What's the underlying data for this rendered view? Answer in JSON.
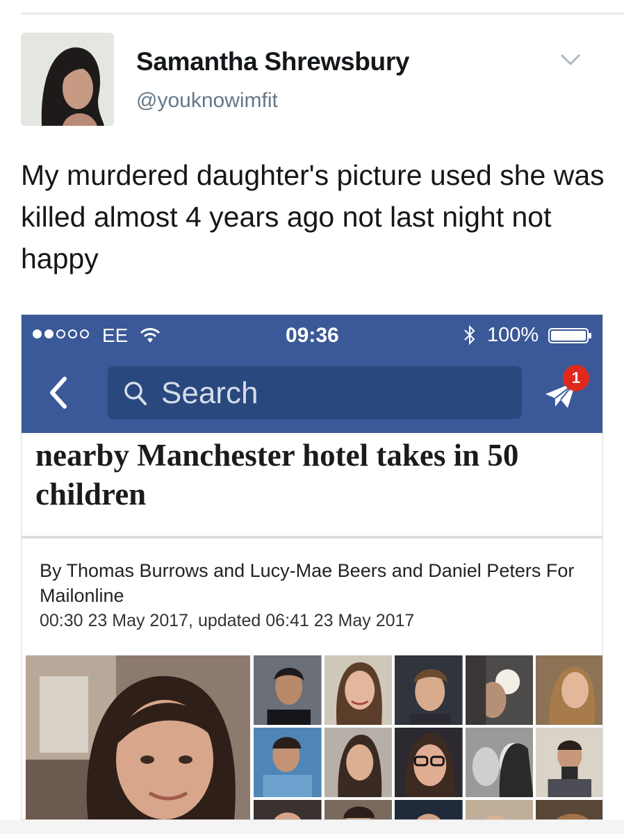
{
  "tweet": {
    "author_name": "Samantha Shrewsbury",
    "author_handle": "@youknowimfit",
    "text": "My murdered daughter's picture used she was killed almost 4 years ago not last night not happy"
  },
  "embedded_screenshot": {
    "status_bar": {
      "carrier": "EE",
      "time": "09:36",
      "battery": "100%"
    },
    "nav": {
      "search_placeholder": "Search",
      "notification_count": "1"
    },
    "article": {
      "headline": "nearby Manchester hotel takes in 50 children",
      "byline": "By Thomas Burrows and Lucy-Mae Beers and Daniel Peters For Mailonline",
      "dateline": "00:30 23 May 2017, updated 06:41 23 May 2017"
    }
  },
  "colors": {
    "facebook_blue": "#3b5998",
    "search_field": "#29487d",
    "badge_red": "#e0291d",
    "handle_gray": "#657786"
  },
  "icons": [
    "chevron-down-icon",
    "wifi-icon",
    "bluetooth-icon",
    "battery-icon",
    "back-chevron-icon",
    "search-icon",
    "messenger-icon"
  ]
}
